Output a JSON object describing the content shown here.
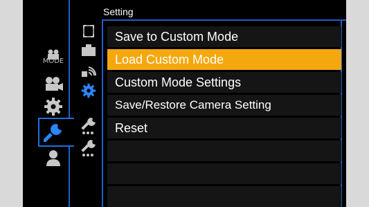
{
  "header": {
    "title": "Setting"
  },
  "sidebar": {
    "categories": [
      {
        "name": "mode",
        "label": "MODE"
      },
      {
        "name": "video"
      },
      {
        "name": "gear"
      },
      {
        "name": "wrench",
        "selected": true
      },
      {
        "name": "person"
      }
    ]
  },
  "subtabs": [
    {
      "name": "frame"
    },
    {
      "name": "camera-body"
    },
    {
      "name": "wireless"
    },
    {
      "name": "gear"
    },
    {
      "name": "wrench-1"
    },
    {
      "name": "wrench-2"
    }
  ],
  "menu": {
    "items": [
      {
        "label": "Save to Custom Mode",
        "selected": false
      },
      {
        "label": "Load Custom Mode",
        "selected": true
      },
      {
        "label": "Custom Mode Settings",
        "selected": false
      },
      {
        "label": "Save/Restore Camera Setting",
        "selected": false
      },
      {
        "label": "Reset",
        "selected": false
      },
      {
        "label": "",
        "selected": false
      },
      {
        "label": "",
        "selected": false
      },
      {
        "label": "",
        "selected": false
      }
    ]
  },
  "colors": {
    "accent_blue": "#1f6fe0",
    "selection": "#f5a80e",
    "background": "#000000"
  }
}
